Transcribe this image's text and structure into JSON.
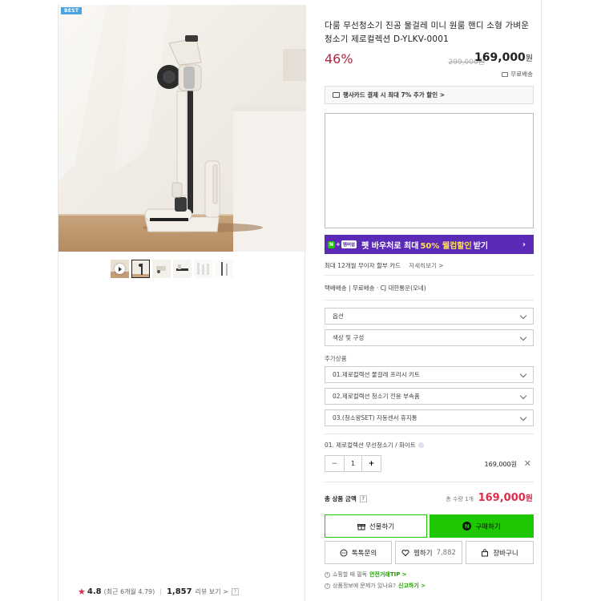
{
  "product": {
    "badge": "BEST",
    "title": "다룸 무선청소기 진공 물걸레 미니 원룸 핸디 소형 가벼운 청소기 제로컬렉션 D-YLKV-0001",
    "discount": "46%",
    "original_price": "299,000원",
    "price_value": "169,000",
    "price_unit": "원",
    "delivery": "무료배송"
  },
  "promo": {
    "card_promo": "행사카드 결제 시 최대 7% 추가 할인 >",
    "npay_tag": "멤버쉽",
    "npay_text_pre": "펫 바우처로 최대",
    "npay_highlight": "50% 웰컴할인",
    "npay_text_post": "받기",
    "npay_arrow": "›"
  },
  "info": {
    "installment": "최대 12개월 무이자 할부 카드",
    "installment_link": "자세히보기 >",
    "shipping": "택배배송  |  무료배송 · CJ 대한통운(오네)"
  },
  "options": {
    "option1": "옵션",
    "option2": "색상 및 구성",
    "addon_label": "추가상품",
    "addons": [
      "01.제로컬렉션 물걸레 프리시 키트",
      "02.제로컬렉션 청소기 전용 부속품",
      "03.(청소왕SET) 자동센서 휴지통"
    ]
  },
  "selected": {
    "name": "01. 제로컬렉션 무선청소기 / 화이트",
    "qty": "1",
    "minus": "−",
    "plus": "+",
    "price": "169,000원",
    "remove": "✕"
  },
  "total": {
    "label": "총 상품 금액",
    "qmark": "?",
    "qty_text": "총 수량 1개",
    "price_value": "169,000",
    "price_unit": "원"
  },
  "buttons": {
    "gift": "선물하기",
    "buy": "구매하기",
    "buy_icon": "N",
    "talk": "톡톡문의",
    "wish": "찜하기",
    "wish_count": "7,882",
    "cart": "장바구니"
  },
  "notes": {
    "note1_text": "쇼핑할 때 필독",
    "note1_link": "안전거래TIP >",
    "note2_text": "상품정보에 문제가 있나요?",
    "note2_link": "신고하기 >"
  },
  "rating": {
    "star": "★",
    "score": "4.8",
    "recent": "(최근 6개월 4.79)",
    "review_count": "1,857",
    "review_link": "리뷰 보기 >",
    "qmark": "?"
  }
}
